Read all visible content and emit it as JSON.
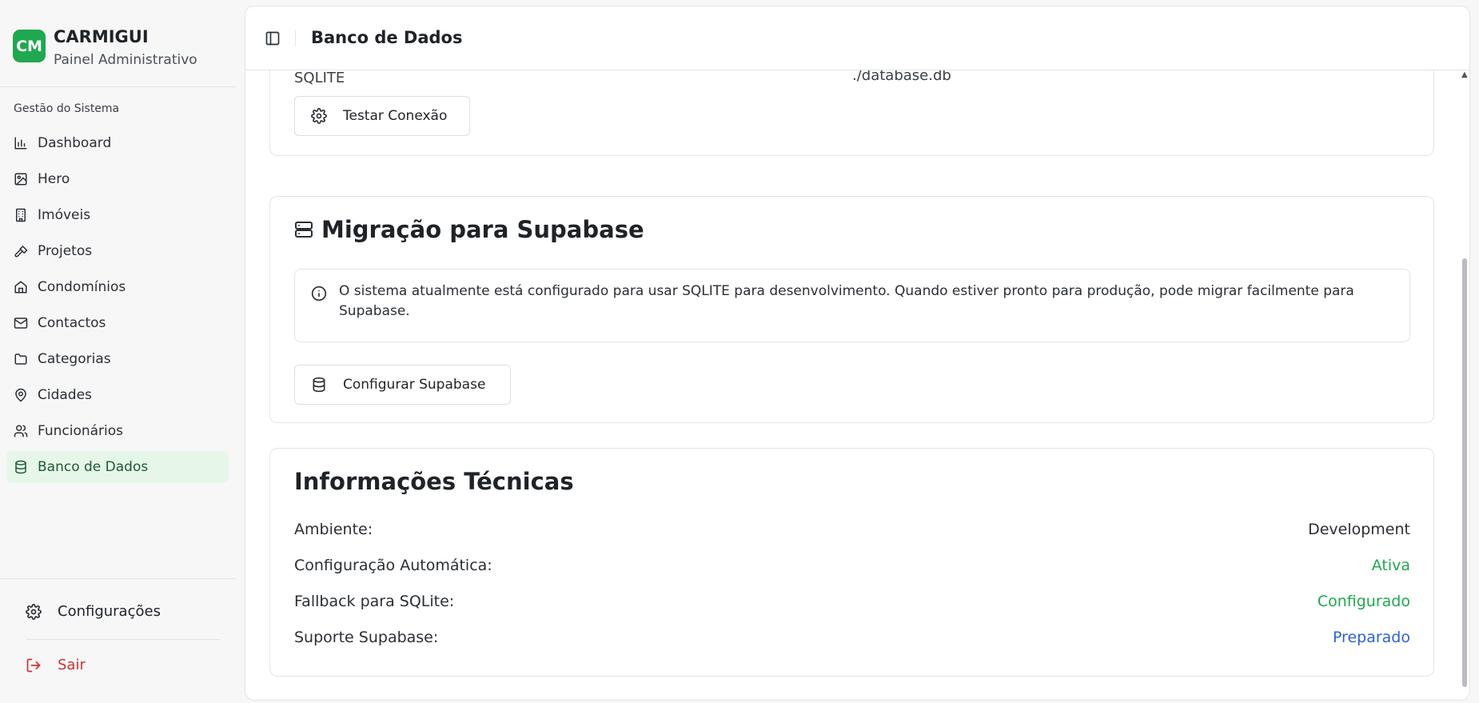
{
  "brand": {
    "logo_text": "CM",
    "name": "CARMIGUI",
    "subtitle": "Painel Administrativo",
    "color": "#1fa84f"
  },
  "sidebar": {
    "section_label": "Gestão do Sistema",
    "items": [
      {
        "label": "Dashboard",
        "icon": "bar-chart-icon"
      },
      {
        "label": "Hero",
        "icon": "image-icon"
      },
      {
        "label": "Imóveis",
        "icon": "building-icon"
      },
      {
        "label": "Projetos",
        "icon": "hammer-icon"
      },
      {
        "label": "Condomínios",
        "icon": "home-icon"
      },
      {
        "label": "Contactos",
        "icon": "mail-icon"
      },
      {
        "label": "Categorias",
        "icon": "folder-icon"
      },
      {
        "label": "Cidades",
        "icon": "map-pin-icon"
      },
      {
        "label": "Funcionários",
        "icon": "users-icon"
      },
      {
        "label": "Banco de Dados",
        "icon": "database-icon",
        "active": true
      }
    ],
    "settings_label": "Configurações",
    "logout_label": "Sair"
  },
  "header": {
    "title": "Banco de Dados"
  },
  "connection": {
    "type": "SQLITE",
    "path": "./database.db",
    "test_button": "Testar Conexão"
  },
  "migration": {
    "title": "Migração para Supabase",
    "alert": "O sistema atualmente está configurado para usar SQLITE para desenvolvimento. Quando estiver pronto para produção, pode migrar facilmente para Supabase.",
    "button": "Configurar Supabase"
  },
  "tech_info": {
    "title": "Informações Técnicas",
    "rows": [
      {
        "label": "Ambiente:",
        "value": "Development",
        "color": "#2a2f35"
      },
      {
        "label": "Configuração Automática:",
        "value": "Ativa",
        "color": "#1fa84f"
      },
      {
        "label": "Fallback para SQLite:",
        "value": "Configurado",
        "color": "#1fa84f"
      },
      {
        "label": "Suporte Supabase:",
        "value": "Preparado",
        "color": "#2a62d8"
      }
    ]
  },
  "colors": {
    "accent_green": "#1fa84f",
    "active_bg": "#e6f7ea",
    "danger": "#d32f2f",
    "link_blue": "#2a62d8"
  }
}
